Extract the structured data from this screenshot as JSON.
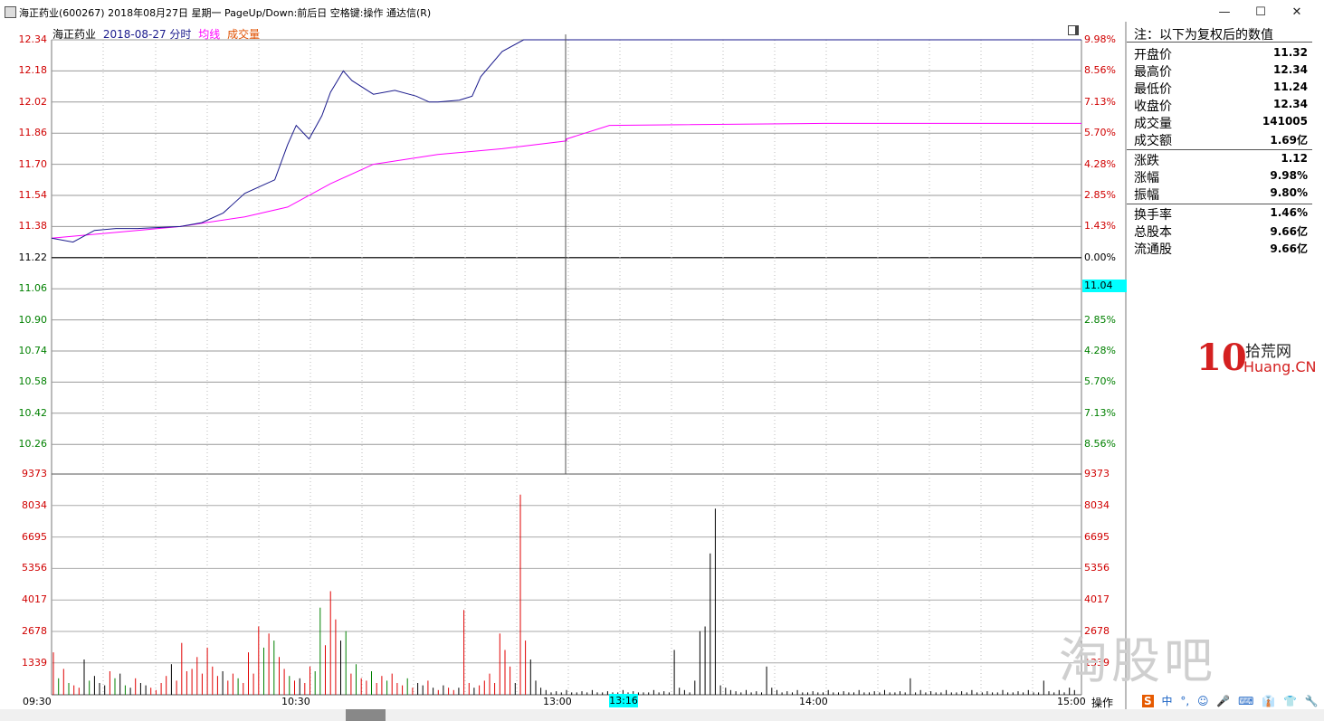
{
  "window": {
    "title": "海正药业(600267) 2018年08月27日 星期一 PageUp/Down:前后日 空格键:操作 通达信(R)",
    "min": "—",
    "max": "☐",
    "close": "✕"
  },
  "header": {
    "name": "海正药业",
    "date": "2018-08-27 分时",
    "avg": "均线",
    "vol": "成交量"
  },
  "price_axis": {
    "left": [
      "12.34",
      "12.18",
      "12.02",
      "11.86",
      "11.70",
      "11.54",
      "11.38",
      "11.22",
      "11.06",
      "10.90",
      "10.74",
      "10.58",
      "10.42",
      "10.26"
    ],
    "right": [
      "9.98%",
      "8.56%",
      "7.13%",
      "5.70%",
      "4.28%",
      "2.85%",
      "1.43%",
      "0.00%",
      "1.43%",
      "2.85%",
      "4.28%",
      "5.70%",
      "7.13%",
      "8.56%"
    ]
  },
  "volume_axis": {
    "labels": [
      "9373",
      "8034",
      "6695",
      "5356",
      "4017",
      "2678",
      "1339"
    ]
  },
  "time_axis": {
    "labels": [
      "09:30",
      "10:30",
      "13:00",
      "14:00",
      "15:00"
    ],
    "cursor_label": "13:16"
  },
  "cursor_price": "11.04",
  "info": {
    "heading": "注：以下为复权后的数值",
    "rows": [
      {
        "k": "开盘价",
        "v": "11.32"
      },
      {
        "k": "最高价",
        "v": "12.34"
      },
      {
        "k": "最低价",
        "v": "11.24"
      },
      {
        "k": "收盘价",
        "v": "12.34"
      },
      {
        "k": "成交量",
        "v": "141005"
      },
      {
        "k": "成交额",
        "v": "1.69亿"
      },
      {
        "k": "涨跌",
        "v": "1.12"
      },
      {
        "k": "涨幅",
        "v": "9.98%"
      },
      {
        "k": "振幅",
        "v": "9.80%"
      },
      {
        "k": "换手率",
        "v": "1.46%"
      },
      {
        "k": "总股本",
        "v": "9.66亿"
      },
      {
        "k": "流通股",
        "v": "9.66亿"
      }
    ]
  },
  "logo": {
    "ten": "10",
    "cn": "拾荒网",
    "en": "Huang.CN"
  },
  "watermark": "淘股吧",
  "bottom": {
    "ops": "操作",
    "tray": [
      "中",
      "°,",
      "☺",
      "🎤",
      "⌨",
      "👔",
      "👕",
      "🔧"
    ],
    "tray_logo": "S"
  },
  "colors": {
    "price": "#1a1a8c",
    "avg": "#ff00ff",
    "up": "#e00000",
    "down": "#008000",
    "flat": "#000000",
    "cyan": "#00ffff",
    "label_up": "#d00000",
    "label_down": "#008000"
  },
  "chart_data": {
    "type": "line",
    "title": "海正药业",
    "series": [
      {
        "name": "分时",
        "x": [
          "09:30",
          "09:35",
          "09:40",
          "09:45",
          "09:50",
          "10:00",
          "10:05",
          "10:10",
          "10:15",
          "10:20",
          "10:22",
          "10:25",
          "10:27",
          "10:30",
          "10:33",
          "10:35",
          "10:38",
          "10:40",
          "10:45",
          "10:50",
          "10:55",
          "10:58",
          "11:00",
          "11:05",
          "11:08",
          "11:10",
          "11:15",
          "11:20",
          "11:30",
          "13:00",
          "14:00",
          "15:00"
        ],
        "values": [
          11.32,
          11.3,
          11.36,
          11.37,
          11.37,
          11.38,
          11.4,
          11.45,
          11.55,
          11.6,
          11.62,
          11.8,
          11.9,
          11.83,
          11.95,
          12.07,
          12.18,
          12.13,
          12.06,
          12.08,
          12.05,
          12.02,
          12.02,
          12.03,
          12.05,
          12.15,
          12.28,
          12.34,
          12.34,
          12.34,
          12.34,
          12.34
        ]
      },
      {
        "name": "均线",
        "x": [
          "09:30",
          "09:45",
          "10:00",
          "10:15",
          "10:25",
          "10:35",
          "10:45",
          "11:00",
          "11:15",
          "11:30",
          "13:00",
          "13:10",
          "14:00",
          "15:00"
        ],
        "values": [
          11.32,
          11.35,
          11.38,
          11.43,
          11.48,
          11.6,
          11.7,
          11.75,
          11.78,
          11.82,
          11.83,
          11.9,
          11.91,
          11.91
        ]
      }
    ],
    "volume": [
      [
        1800,
        "up"
      ],
      [
        700,
        "down"
      ],
      [
        1100,
        "up"
      ],
      [
        500,
        "down"
      ],
      [
        400,
        "up"
      ],
      [
        300,
        "up"
      ],
      [
        1500,
        "flat"
      ],
      [
        600,
        "down"
      ],
      [
        800,
        "flat"
      ],
      [
        500,
        "flat"
      ],
      [
        400,
        "flat"
      ],
      [
        1000,
        "up"
      ],
      [
        700,
        "down"
      ],
      [
        900,
        "flat"
      ],
      [
        400,
        "down"
      ],
      [
        300,
        "flat"
      ],
      [
        700,
        "up"
      ],
      [
        500,
        "flat"
      ],
      [
        400,
        "flat"
      ],
      [
        300,
        "up"
      ],
      [
        200,
        "up"
      ],
      [
        500,
        "up"
      ],
      [
        800,
        "up"
      ],
      [
        1300,
        "flat"
      ],
      [
        600,
        "up"
      ],
      [
        2200,
        "up"
      ],
      [
        1000,
        "up"
      ],
      [
        1100,
        "up"
      ],
      [
        1600,
        "up"
      ],
      [
        900,
        "up"
      ],
      [
        2000,
        "up"
      ],
      [
        1200,
        "up"
      ],
      [
        800,
        "up"
      ],
      [
        1000,
        "flat"
      ],
      [
        600,
        "up"
      ],
      [
        900,
        "up"
      ],
      [
        700,
        "down"
      ],
      [
        500,
        "up"
      ],
      [
        1800,
        "up"
      ],
      [
        900,
        "up"
      ],
      [
        2900,
        "up"
      ],
      [
        2000,
        "down"
      ],
      [
        2600,
        "up"
      ],
      [
        2300,
        "down"
      ],
      [
        1600,
        "up"
      ],
      [
        1100,
        "up"
      ],
      [
        800,
        "down"
      ],
      [
        600,
        "up"
      ],
      [
        700,
        "flat"
      ],
      [
        500,
        "up"
      ],
      [
        1200,
        "up"
      ],
      [
        1000,
        "down"
      ],
      [
        3700,
        "down"
      ],
      [
        2100,
        "up"
      ],
      [
        4400,
        "up"
      ],
      [
        3200,
        "up"
      ],
      [
        2300,
        "flat"
      ],
      [
        2700,
        "down"
      ],
      [
        900,
        "up"
      ],
      [
        1300,
        "down"
      ],
      [
        700,
        "up"
      ],
      [
        600,
        "up"
      ],
      [
        1000,
        "down"
      ],
      [
        500,
        "up"
      ],
      [
        800,
        "up"
      ],
      [
        600,
        "down"
      ],
      [
        900,
        "up"
      ],
      [
        500,
        "up"
      ],
      [
        400,
        "up"
      ],
      [
        700,
        "down"
      ],
      [
        300,
        "up"
      ],
      [
        500,
        "flat"
      ],
      [
        400,
        "flat"
      ],
      [
        600,
        "up"
      ],
      [
        300,
        "flat"
      ],
      [
        200,
        "up"
      ],
      [
        400,
        "flat"
      ],
      [
        300,
        "up"
      ],
      [
        200,
        "up"
      ],
      [
        300,
        "flat"
      ],
      [
        3600,
        "up"
      ],
      [
        500,
        "up"
      ],
      [
        300,
        "flat"
      ],
      [
        400,
        "up"
      ],
      [
        600,
        "up"
      ],
      [
        900,
        "up"
      ],
      [
        500,
        "up"
      ],
      [
        2600,
        "up"
      ],
      [
        1900,
        "up"
      ],
      [
        1200,
        "up"
      ],
      [
        500,
        "flat"
      ],
      [
        8500,
        "up"
      ],
      [
        2300,
        "up"
      ],
      [
        1500,
        "flat"
      ],
      [
        600,
        "flat"
      ],
      [
        300,
        "flat"
      ],
      [
        200,
        "flat"
      ],
      [
        100,
        "flat"
      ],
      [
        150,
        "flat"
      ],
      [
        100,
        "flat"
      ],
      [
        200,
        "flat"
      ],
      [
        100,
        "flat"
      ],
      [
        100,
        "flat"
      ],
      [
        150,
        "flat"
      ],
      [
        100,
        "flat"
      ],
      [
        200,
        "flat"
      ],
      [
        100,
        "flat"
      ],
      [
        100,
        "flat"
      ],
      [
        150,
        "flat"
      ],
      [
        100,
        "flat"
      ],
      [
        100,
        "flat"
      ],
      [
        200,
        "flat"
      ],
      [
        100,
        "flat"
      ],
      [
        150,
        "flat"
      ],
      [
        100,
        "flat"
      ],
      [
        100,
        "flat"
      ],
      [
        100,
        "flat"
      ],
      [
        200,
        "flat"
      ],
      [
        100,
        "flat"
      ],
      [
        150,
        "flat"
      ],
      [
        100,
        "flat"
      ],
      [
        1900,
        "flat"
      ],
      [
        300,
        "flat"
      ],
      [
        200,
        "flat"
      ],
      [
        100,
        "flat"
      ],
      [
        600,
        "flat"
      ],
      [
        2700,
        "flat"
      ],
      [
        2900,
        "flat"
      ],
      [
        6000,
        "flat"
      ],
      [
        7900,
        "flat"
      ],
      [
        400,
        "flat"
      ],
      [
        300,
        "flat"
      ],
      [
        200,
        "flat"
      ],
      [
        150,
        "flat"
      ],
      [
        100,
        "flat"
      ],
      [
        200,
        "flat"
      ],
      [
        100,
        "flat"
      ],
      [
        150,
        "flat"
      ],
      [
        100,
        "flat"
      ],
      [
        1200,
        "flat"
      ],
      [
        300,
        "flat"
      ],
      [
        200,
        "flat"
      ],
      [
        100,
        "flat"
      ],
      [
        150,
        "flat"
      ],
      [
        100,
        "flat"
      ],
      [
        200,
        "flat"
      ],
      [
        100,
        "flat"
      ],
      [
        100,
        "flat"
      ],
      [
        150,
        "flat"
      ],
      [
        100,
        "flat"
      ],
      [
        100,
        "flat"
      ],
      [
        200,
        "flat"
      ],
      [
        100,
        "flat"
      ],
      [
        100,
        "flat"
      ],
      [
        150,
        "flat"
      ],
      [
        100,
        "flat"
      ],
      [
        100,
        "flat"
      ],
      [
        200,
        "flat"
      ],
      [
        100,
        "flat"
      ],
      [
        100,
        "flat"
      ],
      [
        150,
        "flat"
      ],
      [
        100,
        "flat"
      ],
      [
        200,
        "flat"
      ],
      [
        100,
        "flat"
      ],
      [
        100,
        "flat"
      ],
      [
        150,
        "flat"
      ],
      [
        100,
        "flat"
      ],
      [
        700,
        "flat"
      ],
      [
        100,
        "flat"
      ],
      [
        200,
        "flat"
      ],
      [
        100,
        "flat"
      ],
      [
        150,
        "flat"
      ],
      [
        100,
        "flat"
      ],
      [
        100,
        "flat"
      ],
      [
        200,
        "flat"
      ],
      [
        100,
        "flat"
      ],
      [
        100,
        "flat"
      ],
      [
        150,
        "flat"
      ],
      [
        100,
        "flat"
      ],
      [
        200,
        "flat"
      ],
      [
        100,
        "flat"
      ],
      [
        100,
        "flat"
      ],
      [
        150,
        "flat"
      ],
      [
        100,
        "flat"
      ],
      [
        100,
        "flat"
      ],
      [
        200,
        "flat"
      ],
      [
        100,
        "flat"
      ],
      [
        100,
        "flat"
      ],
      [
        150,
        "flat"
      ],
      [
        100,
        "flat"
      ],
      [
        200,
        "flat"
      ],
      [
        100,
        "flat"
      ],
      [
        100,
        "flat"
      ],
      [
        600,
        "flat"
      ],
      [
        150,
        "flat"
      ],
      [
        100,
        "flat"
      ],
      [
        200,
        "flat"
      ],
      [
        100,
        "flat"
      ],
      [
        300,
        "flat"
      ],
      [
        200,
        "flat"
      ]
    ],
    "volume_ylim": [
      0,
      9373
    ],
    "ylim": [
      10.26,
      12.34
    ],
    "prev_close": 11.22
  }
}
